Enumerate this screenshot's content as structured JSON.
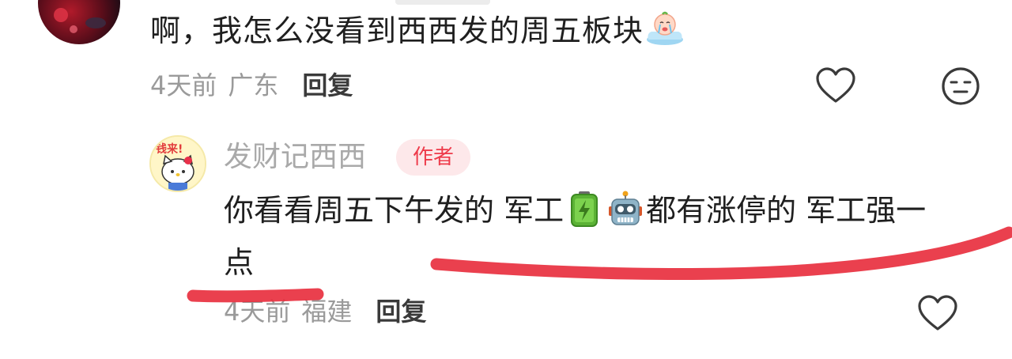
{
  "comment_main": {
    "text": "啊，我怎么没看到西西发的周五板块",
    "emoji": "crying-face-emoji",
    "time": "4天前",
    "location": "广东",
    "reply_label": "回复"
  },
  "reply": {
    "author": "发财记西西",
    "author_badge": "作者",
    "avatar_text": "钱来!",
    "line1_part1": "你看看周五下午发的 军工",
    "line1_part2": "都有涨停的 军工强一",
    "line2": "点",
    "emoji_1": "battery-emoji",
    "emoji_2": "robot-emoji",
    "time": "4天前",
    "location": "福建",
    "reply_label": "回复"
  },
  "icons": {
    "like": "heart-outline-icon",
    "emoji_react": "neutral-face-icon"
  },
  "colors": {
    "author_badge_bg": "#fde8ea",
    "author_badge_text": "#ee3b4b",
    "scribble": "#e8303f"
  }
}
